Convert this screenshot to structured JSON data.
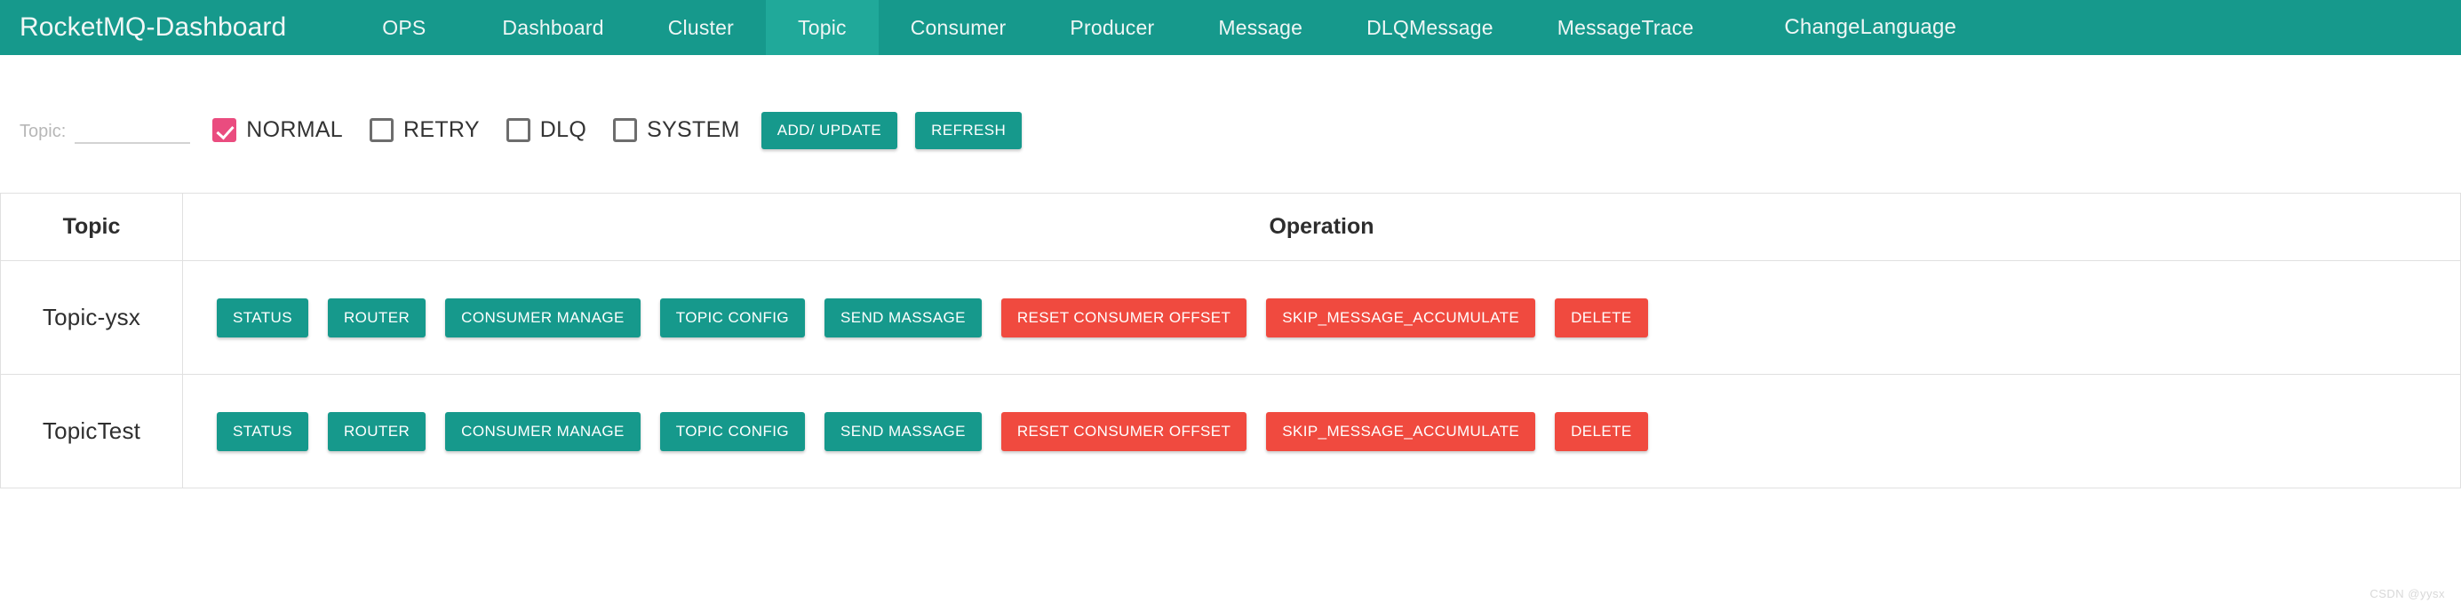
{
  "navbar": {
    "brand": "RocketMQ-Dashboard",
    "items": [
      {
        "label": "OPS",
        "active": false
      },
      {
        "label": "Dashboard",
        "active": false
      },
      {
        "label": "Cluster",
        "active": false
      },
      {
        "label": "Topic",
        "active": true
      },
      {
        "label": "Consumer",
        "active": false
      },
      {
        "label": "Producer",
        "active": false
      },
      {
        "label": "Message",
        "active": false
      },
      {
        "label": "DLQMessage",
        "active": false
      },
      {
        "label": "MessageTrace",
        "active": false
      },
      {
        "label": "ChangeLanguage",
        "active": false
      }
    ],
    "accent_color": "#16998c",
    "active_color": "#20a99a"
  },
  "toolbar": {
    "topic_label": "Topic:",
    "topic_value": "",
    "topic_placeholder": "",
    "filters": [
      {
        "label": "NORMAL",
        "checked": true
      },
      {
        "label": "RETRY",
        "checked": false
      },
      {
        "label": "DLQ",
        "checked": false
      },
      {
        "label": "SYSTEM",
        "checked": false
      }
    ],
    "checked_color": "#ea4c7f",
    "add_update_label": "ADD/ UPDATE",
    "refresh_label": "REFRESH"
  },
  "table": {
    "headers": {
      "topic": "Topic",
      "operation": "Operation"
    },
    "rows": [
      {
        "topic": "Topic-ysx",
        "actions": [
          {
            "label": "STATUS",
            "style": "teal"
          },
          {
            "label": "ROUTER",
            "style": "teal"
          },
          {
            "label": "CONSUMER MANAGE",
            "style": "teal"
          },
          {
            "label": "TOPIC CONFIG",
            "style": "teal"
          },
          {
            "label": "SEND MASSAGE",
            "style": "teal"
          },
          {
            "label": "RESET CONSUMER OFFSET",
            "style": "red"
          },
          {
            "label": "SKIP_MESSAGE_ACCUMULATE",
            "style": "red"
          },
          {
            "label": "DELETE",
            "style": "red"
          }
        ]
      },
      {
        "topic": "TopicTest",
        "actions": [
          {
            "label": "STATUS",
            "style": "teal"
          },
          {
            "label": "ROUTER",
            "style": "teal"
          },
          {
            "label": "CONSUMER MANAGE",
            "style": "teal"
          },
          {
            "label": "TOPIC CONFIG",
            "style": "teal"
          },
          {
            "label": "SEND MASSAGE",
            "style": "teal"
          },
          {
            "label": "RESET CONSUMER OFFSET",
            "style": "red"
          },
          {
            "label": "SKIP_MESSAGE_ACCUMULATE",
            "style": "red"
          },
          {
            "label": "DELETE",
            "style": "red"
          }
        ]
      }
    ],
    "button_colors": {
      "teal": "#16998c",
      "red": "#f04a3f"
    }
  },
  "watermark": "CSDN @yysx"
}
